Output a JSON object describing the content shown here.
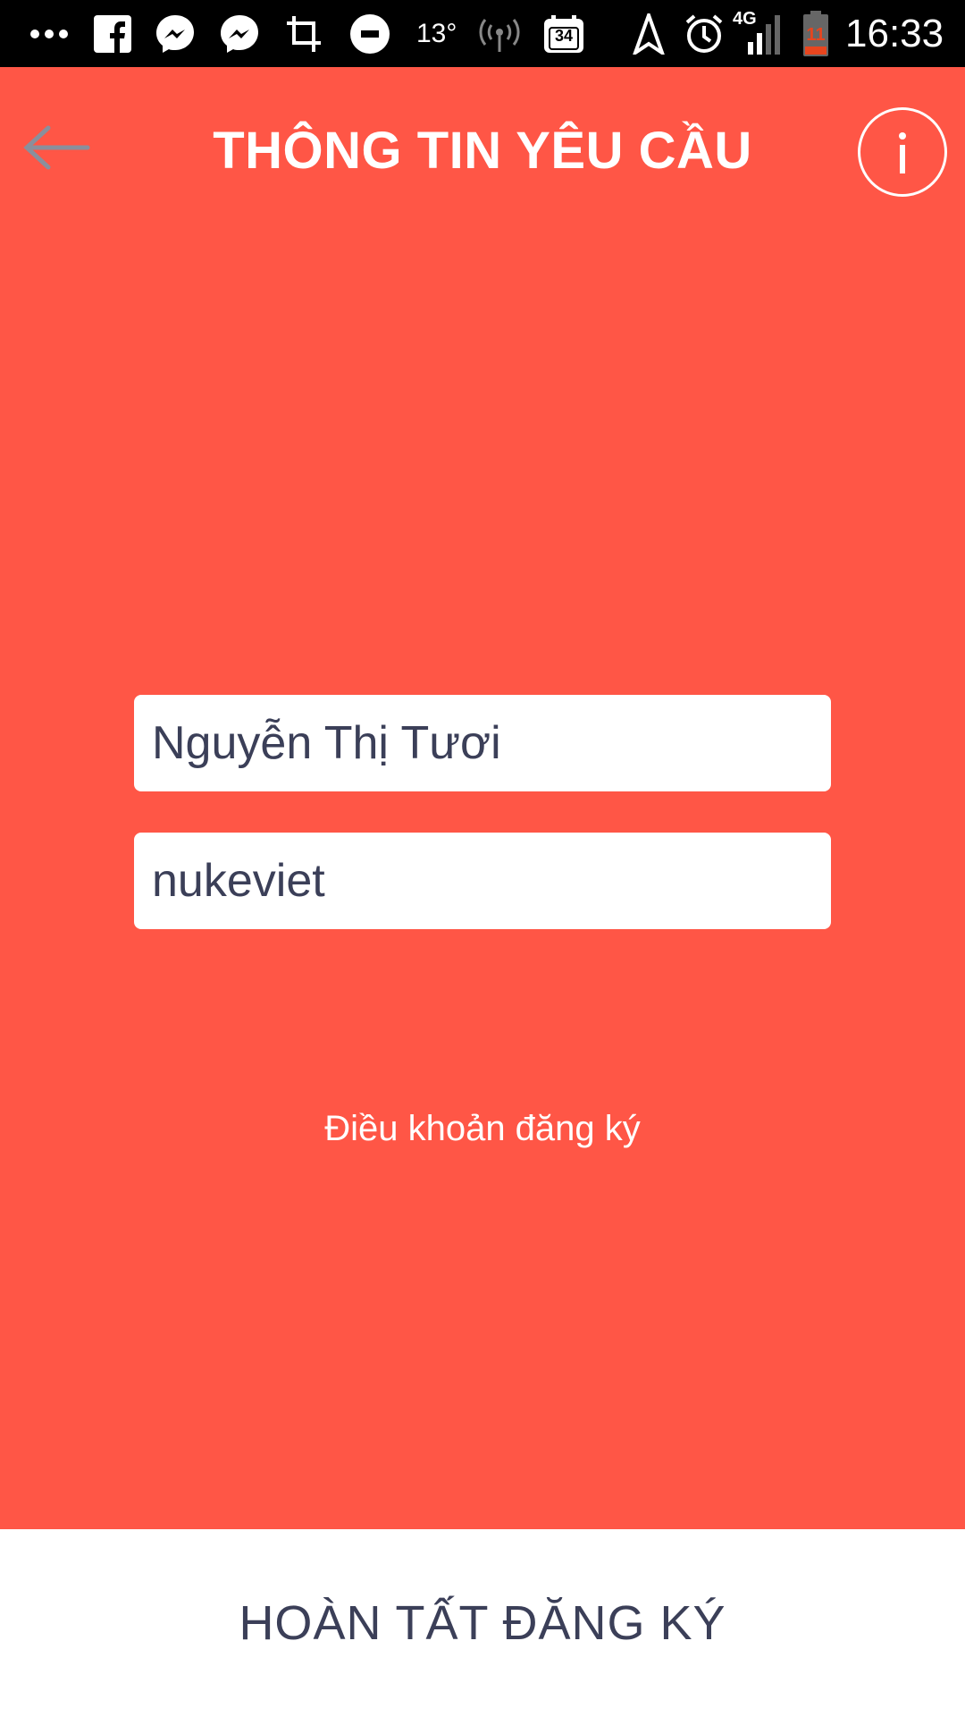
{
  "status_bar": {
    "icons": [
      "more-icon",
      "facebook-icon",
      "messenger-icon",
      "messenger-icon",
      "crop-icon",
      "uber-icon",
      "wifi-hotspot-icon",
      "calendar-icon",
      "navigation-icon",
      "alarm-icon",
      "signal-icon",
      "battery-icon"
    ],
    "temperature": "13°",
    "calendar_day": "34",
    "network": "4G",
    "battery_level": "11",
    "time": "16:33"
  },
  "header": {
    "title": "THÔNG TIN YÊU CẦU",
    "back_icon": "back-arrow-icon",
    "info_icon": "info-icon"
  },
  "form": {
    "name_value": "Nguyễn Thị Tươi",
    "username_value": "nukeviet"
  },
  "terms_link": "Điều khoản đăng ký",
  "submit_button": "HOÀN TẤT ĐĂNG KÝ",
  "colors": {
    "background": "#ff5646",
    "text_dark": "#3b3f58",
    "white": "#ffffff",
    "back_arrow": "#8a8f9c"
  }
}
